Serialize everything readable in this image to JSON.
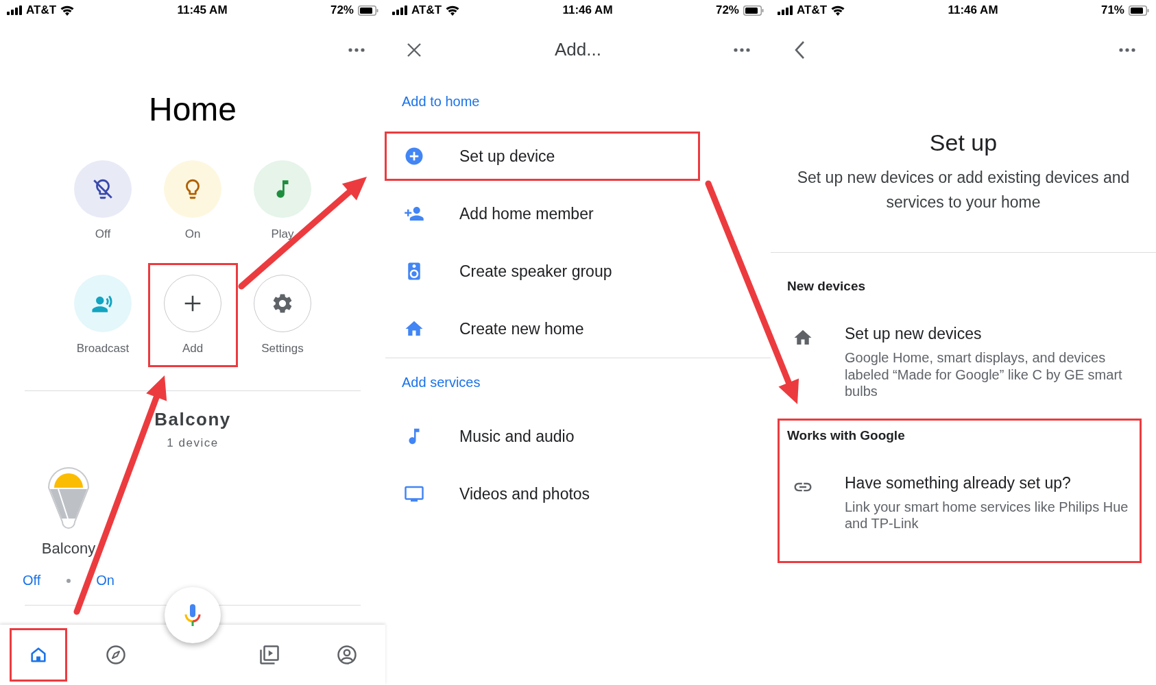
{
  "home_screen": {
    "status_bar": {
      "carrier": "AT&T",
      "time": "11:45 AM",
      "battery": "72%"
    },
    "title": "Home",
    "actions": [
      {
        "kind": "lights_off",
        "label": "Off",
        "highlighted": false
      },
      {
        "kind": "lights_on",
        "label": "On",
        "highlighted": false
      },
      {
        "kind": "play",
        "label": "Play",
        "highlighted": false
      },
      {
        "kind": "broadcast",
        "label": "Broadcast",
        "highlighted": false
      },
      {
        "kind": "add",
        "label": "Add",
        "highlighted": true
      },
      {
        "kind": "settings",
        "label": "Settings",
        "highlighted": false
      }
    ],
    "room": {
      "name": "Balcony",
      "count": "1 device",
      "device": {
        "name": "Balcony",
        "off_label": "Off",
        "on_label": "On"
      }
    },
    "nav": [
      {
        "kind": "home",
        "selected": true,
        "highlighted": true
      },
      {
        "kind": "discover",
        "selected": false,
        "highlighted": false
      },
      {
        "kind": "media",
        "selected": false,
        "highlighted": false
      },
      {
        "kind": "account",
        "selected": false,
        "highlighted": false
      }
    ]
  },
  "add_screen": {
    "status_bar": {
      "carrier": "AT&T",
      "time": "11:46 AM",
      "battery": "72%"
    },
    "title": "Add...",
    "sections": [
      {
        "heading": "Add to home",
        "items": [
          {
            "kind": "add_circle",
            "label": "Set up device",
            "highlighted": true
          },
          {
            "kind": "person_add",
            "label": "Add home member",
            "highlighted": false
          },
          {
            "kind": "speaker",
            "label": "Create speaker group",
            "highlighted": false
          },
          {
            "kind": "home",
            "label": "Create new home",
            "highlighted": false
          }
        ]
      },
      {
        "heading": "Add services",
        "items": [
          {
            "kind": "music",
            "label": "Music and audio",
            "highlighted": false
          },
          {
            "kind": "tv",
            "label": "Videos and photos",
            "highlighted": false
          }
        ]
      }
    ]
  },
  "setup_screen": {
    "status_bar": {
      "carrier": "AT&T",
      "time": "11:46 AM",
      "battery": "71%"
    },
    "title": "Set up",
    "subtitle": "Set up new devices or add existing devices and services to your home",
    "sections": [
      {
        "heading": "New devices",
        "highlighted": false,
        "items": [
          {
            "kind": "home",
            "title": "Set up new devices",
            "description": "Google Home, smart displays, and devices labeled “Made for Google” like C by GE smart bulbs"
          }
        ]
      },
      {
        "heading": "Works with Google",
        "highlighted": true,
        "items": [
          {
            "kind": "link",
            "title": "Have something already set up?",
            "description": "Link your smart home services like Philips Hue and TP-Link"
          }
        ]
      }
    ]
  }
}
